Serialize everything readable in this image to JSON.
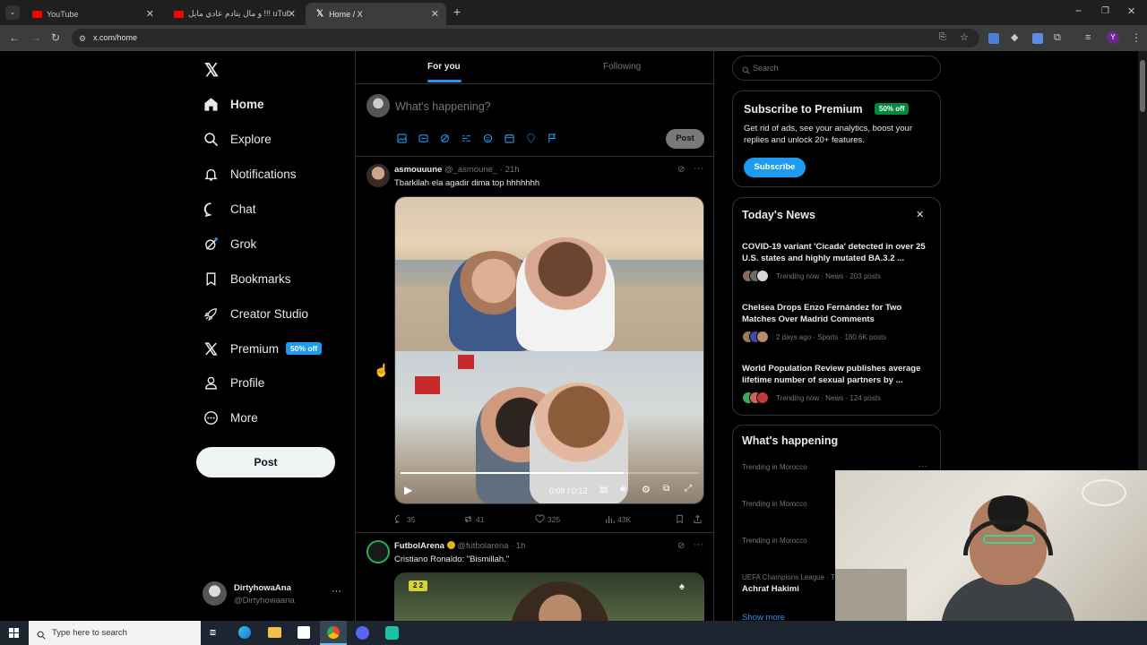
{
  "browser": {
    "tabs": [
      {
        "label": "YouTube",
        "favicon": "youtube-icon"
      },
      {
        "label": "و مال يتادم عادي مايل !!! uTube",
        "favicon": "youtube-icon"
      },
      {
        "label": "Home / X",
        "favicon": "x-logo-icon"
      }
    ],
    "url": "x.com/home",
    "profile_initial": "Y"
  },
  "sidebar": {
    "items": [
      {
        "label": "Home",
        "icon": "home-icon"
      },
      {
        "label": "Explore",
        "icon": "search-icon"
      },
      {
        "label": "Notifications",
        "icon": "bell-icon"
      },
      {
        "label": "Chat",
        "icon": "chat-icon"
      },
      {
        "label": "Grok",
        "icon": "grok-icon"
      },
      {
        "label": "Bookmarks",
        "icon": "bookmark-icon"
      },
      {
        "label": "Creator Studio",
        "icon": "rocket-icon"
      },
      {
        "label": "Premium",
        "icon": "x-logo-icon",
        "badge": "50% off"
      },
      {
        "label": "Profile",
        "icon": "person-icon"
      },
      {
        "label": "More",
        "icon": "more-circle-icon"
      }
    ],
    "post_button": "Post",
    "account": {
      "name": "DirtyhowaAna",
      "handle": "@Dirtyhowaana"
    }
  },
  "feed": {
    "tabs": [
      "For you",
      "Following"
    ],
    "composer_placeholder": "What's happening?",
    "composer_post": "Post",
    "tweets": [
      {
        "author": "asmouuune",
        "handle": "@_asmoune_",
        "time": "· 21h",
        "text": "Tbarkllah ela agadir dima top hhhhhhh",
        "video_time": "0:09 / 0:12",
        "video_progress": 0.75,
        "replies": "35",
        "reposts": "41",
        "likes": "325",
        "views": "43K"
      },
      {
        "author": "FutbolArena",
        "handle": "@futbolarena",
        "time": "· 1h",
        "text": "Cristiano Ronaldo: \"Bismillah.\"",
        "score": "2 2"
      }
    ]
  },
  "right": {
    "search_placeholder": "Search",
    "premium": {
      "title": "Subscribe to Premium",
      "badge": "50% off",
      "body": "Get rid of ads, see your analytics, boost your replies and unlock 20+ features.",
      "button": "Subscribe"
    },
    "news": {
      "title": "Today's News",
      "items": [
        {
          "headline": "COVID-19 variant 'Cicada' detected in over 25 U.S. states and highly mutated BA.3.2 ...",
          "meta": "Trending now · News · 203 posts"
        },
        {
          "headline": "Chelsea Drops Enzo Fernández for Two Matches Over Madrid Comments",
          "meta": "2 days ago · Sports · 180.6K posts"
        },
        {
          "headline": "World Population Review publishes average lifetime number of sexual partners by ...",
          "meta": "Trending now · News · 124 posts"
        }
      ]
    },
    "happening": {
      "title": "What's happening",
      "items": [
        {
          "context": "Trending in Morocco",
          "topic": ""
        },
        {
          "context": "Trending in Morocco",
          "topic": ""
        },
        {
          "context": "Trending in Morocco",
          "topic": ""
        },
        {
          "context": "UEFA Champions League · T",
          "topic": "Achraf Hakimi"
        }
      ],
      "show_more": "Show more"
    }
  },
  "taskbar": {
    "search_placeholder": "Type here to search"
  },
  "colors": {
    "accent": "#1d9bf0",
    "background": "#000000",
    "border": "#2f3336",
    "muted": "#71767b"
  }
}
